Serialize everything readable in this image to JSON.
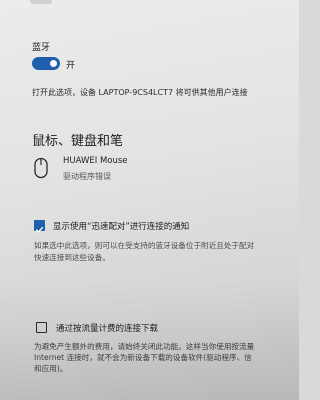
{
  "top": {
    "add_button_glyph": "+"
  },
  "bluetooth": {
    "label": "蓝牙",
    "toggle_state_label": "开",
    "toggle_on": true,
    "toggle_color": "#1f5fae",
    "discoverable_text": "打开此选项，设备 LAPTOP-9CS4LCT7 将可供其他用户连接"
  },
  "devices_section": {
    "heading": "鼠标、键盘和笔",
    "devices": [
      {
        "icon": "mouse-icon",
        "name": "HUAWEI  Mouse",
        "status": "驱动程序错误"
      }
    ]
  },
  "swift_pair": {
    "checked": true,
    "label": "显示使用“迅速配对”进行连接的通知",
    "description_lines": [
      "如果选中此选项，则可以在受支持的蓝牙设备位于附近且处于配对",
      "快速连接到这些设备。"
    ]
  },
  "metered": {
    "checked": false,
    "label": "通过按流量计费的连接下载",
    "description_lines": [
      "为避免产生额外的费用，请始终关闭此功能。这样当你使用按流量",
      "Internet 连接时，就不会为新设备下载的设备软件(驱动程序、信",
      "和应用)。"
    ]
  }
}
